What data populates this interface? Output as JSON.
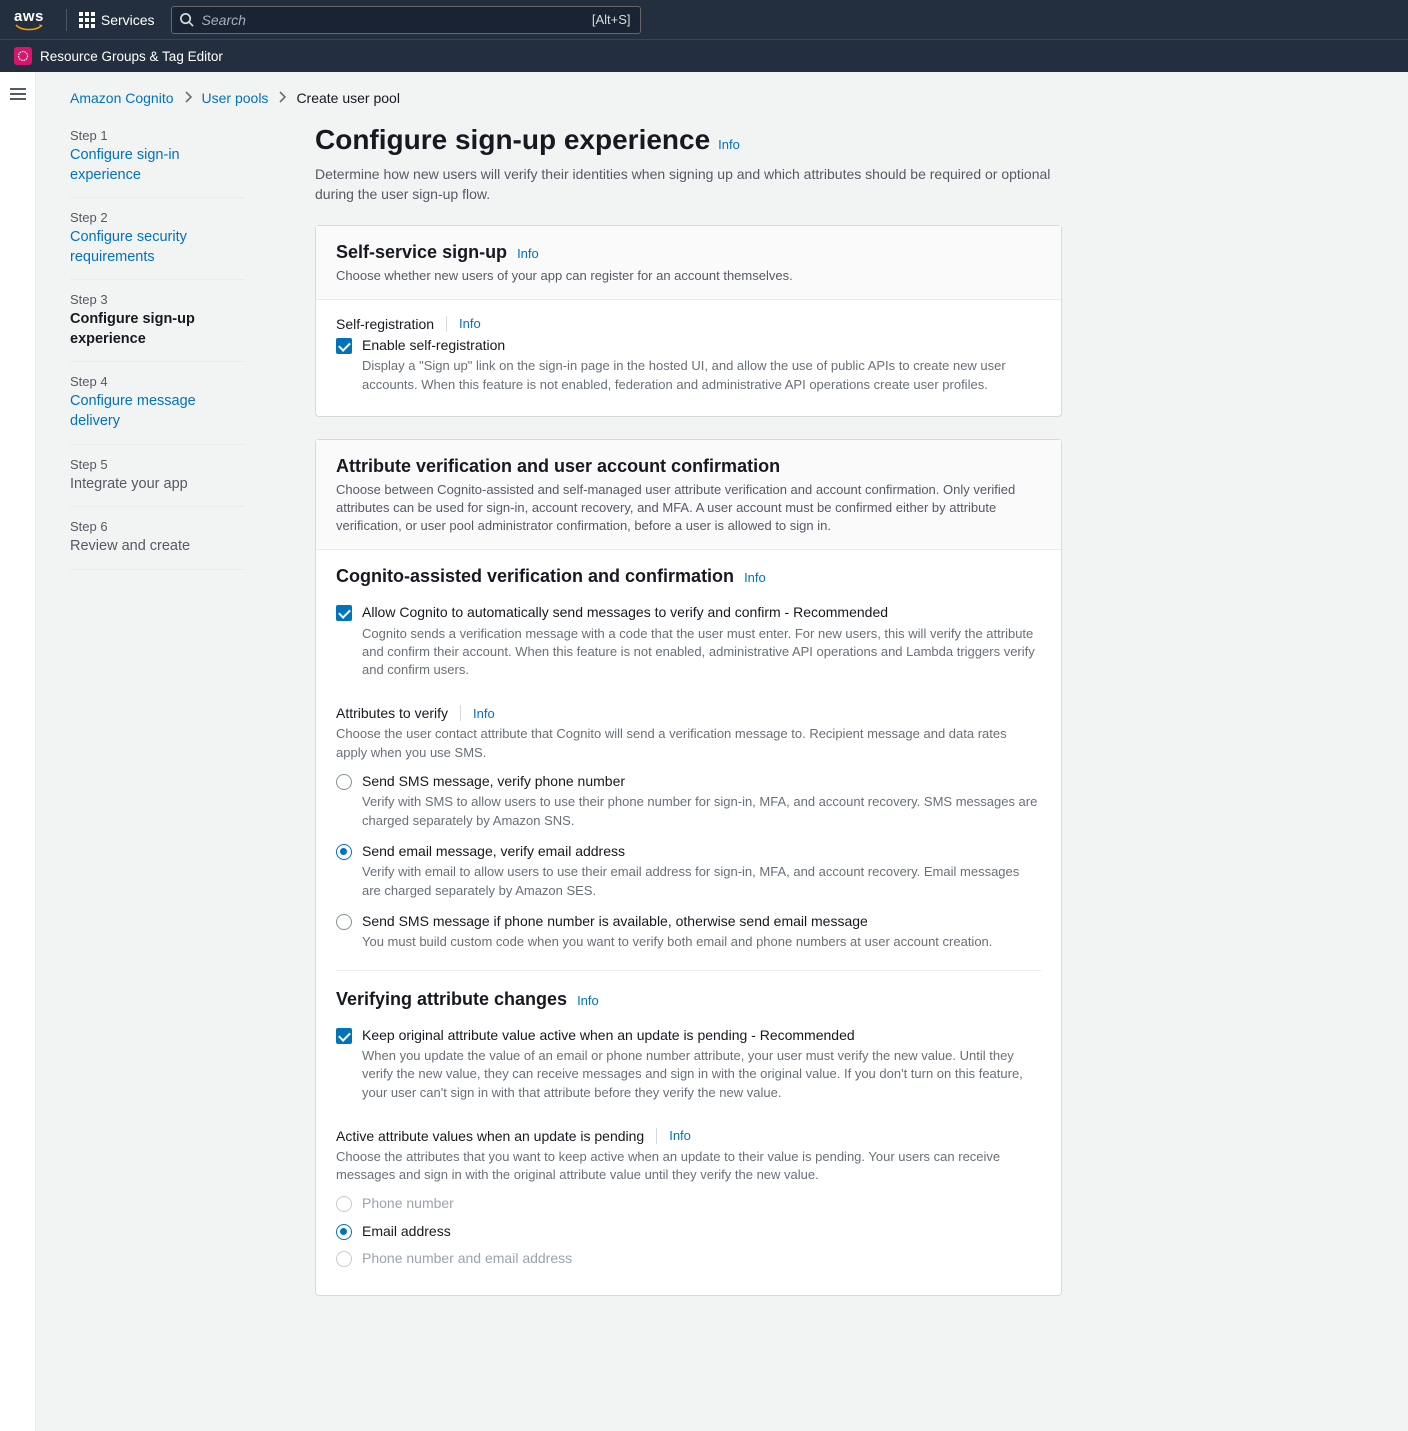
{
  "header": {
    "services": "Services",
    "search_placeholder": "Search",
    "shortcut": "[Alt+S]",
    "subhead": "Resource Groups & Tag Editor"
  },
  "breadcrumbs": {
    "a": "Amazon Cognito",
    "b": "User pools",
    "c": "Create user pool"
  },
  "steps": [
    {
      "num": "Step 1",
      "title": "Configure sign-in experience",
      "state": "link"
    },
    {
      "num": "Step 2",
      "title": "Configure security requirements",
      "state": "link"
    },
    {
      "num": "Step 3",
      "title": "Configure sign-up experience",
      "state": "active"
    },
    {
      "num": "Step 4",
      "title": "Configure message delivery",
      "state": "link"
    },
    {
      "num": "Step 5",
      "title": "Integrate your app",
      "state": "muted"
    },
    {
      "num": "Step 6",
      "title": "Review and create",
      "state": "muted"
    }
  ],
  "page": {
    "title": "Configure sign-up experience",
    "info": "Info",
    "desc": "Determine how new users will verify their identities when signing up and which attributes should be required or optional during the user sign-up flow."
  },
  "self_service": {
    "title": "Self-service sign-up",
    "info": "Info",
    "desc": "Choose whether new users of your app can register for an account themselves.",
    "field_label": "Self-registration",
    "field_info": "Info",
    "check_label": "Enable self-registration",
    "check_desc": "Display a \"Sign up\" link on the sign-in page in the hosted UI, and allow the use of public APIs to create new user accounts. When this feature is not enabled, federation and administrative API operations create user profiles."
  },
  "attr_verif": {
    "title": "Attribute verification and user account confirmation",
    "desc": "Choose between Cognito-assisted and self-managed user attribute verification and account confirmation. Only verified attributes can be used for sign-in, account recovery, and MFA. A user account must be confirmed either by attribute verification, or user pool administrator confirmation, before a user is allowed to sign in.",
    "cognito_heading": "Cognito-assisted verification and confirmation",
    "cognito_info": "Info",
    "allow_label": "Allow Cognito to automatically send messages to verify and confirm - Recommended",
    "allow_desc": "Cognito sends a verification message with a code that the user must enter. For new users, this will verify the attribute and confirm their account. When this feature is not enabled, administrative API operations and Lambda triggers verify and confirm users.",
    "attrs_label": "Attributes to verify",
    "attrs_info": "Info",
    "attrs_desc": "Choose the user contact attribute that Cognito will send a verification message to. Recipient message and data rates apply when you use SMS.",
    "opt1_label": "Send SMS message, verify phone number",
    "opt1_desc": "Verify with SMS to allow users to use their phone number for sign-in, MFA, and account recovery. SMS messages are charged separately by Amazon SNS.",
    "opt2_label": "Send email message, verify email address",
    "opt2_desc": "Verify with email to allow users to use their email address for sign-in, MFA, and account recovery. Email messages are charged separately by Amazon SES.",
    "opt3_label": "Send SMS message if phone number is available, otherwise send email message",
    "opt3_desc": "You must build custom code when you want to verify both email and phone numbers at user account creation.",
    "verif_changes_heading": "Verifying attribute changes",
    "verif_changes_info": "Info",
    "keep_label": "Keep original attribute value active when an update is pending - Recommended",
    "keep_desc": "When you update the value of an email or phone number attribute, your user must verify the new value. Until they verify the new value, they can receive messages and sign in with the original value. If you don't turn on this feature, your user can't sign in with that attribute before they verify the new value.",
    "active_label": "Active attribute values when an update is pending",
    "active_info": "Info",
    "active_desc": "Choose the attributes that you want to keep active when an update to their value is pending. Your users can receive messages and sign in with the original attribute value until they verify the new value.",
    "active_opt1": "Phone number",
    "active_opt2": "Email address",
    "active_opt3": "Phone number and email address"
  }
}
